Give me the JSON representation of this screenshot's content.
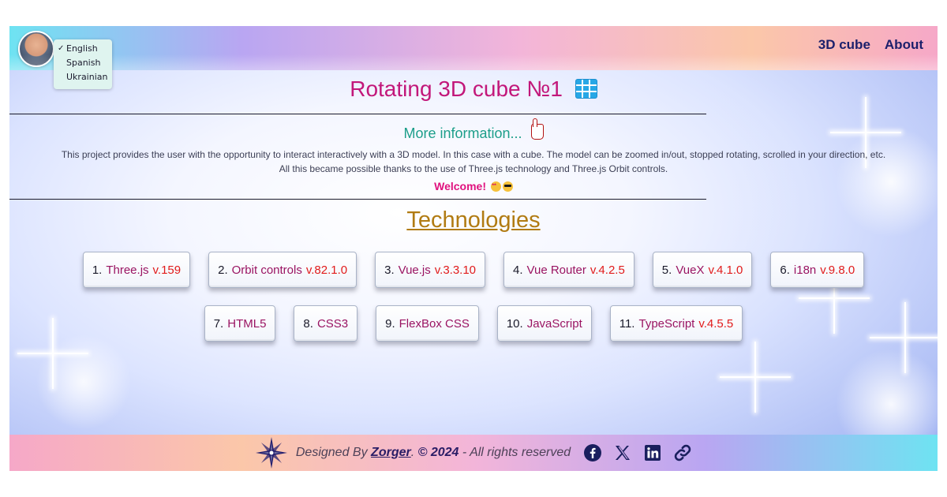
{
  "header": {
    "languages": [
      {
        "label": "English",
        "selected": true,
        "check": "✓"
      },
      {
        "label": "Spanish",
        "selected": false
      },
      {
        "label": "Ukrainian",
        "selected": false
      }
    ],
    "nav": [
      {
        "label": "3D cube"
      },
      {
        "label": "About"
      }
    ]
  },
  "main": {
    "title": "Rotating 3D cube №1",
    "title_icon": "grid-table-icon",
    "more_info": "More information...",
    "more_info_icon": "pointing-hand-icon",
    "description_line1": "This project provides the user with the opportunity to interact interactively with a 3D model. In this case with a cube. The model can be zoomed in/out, stopped rotating, scrolled in your direction, etc.",
    "description_line2": "All this became possible thanks to the use of Three.js technology and Three.js Orbit controls.",
    "welcome": "Welcome!",
    "technologies_title": "Technologies",
    "technologies_row1": [
      {
        "num": "1.",
        "name": "Three.js",
        "version": "v.159"
      },
      {
        "num": "2.",
        "name": "Orbit controls",
        "version": "v.82.1.0"
      },
      {
        "num": "3.",
        "name": "Vue.js",
        "version": "v.3.3.10"
      },
      {
        "num": "4.",
        "name": "Vue Router",
        "version": "v.4.2.5"
      },
      {
        "num": "5.",
        "name": "VueX",
        "version": "v.4.1.0"
      },
      {
        "num": "6.",
        "name": "i18n",
        "version": "v.9.8.0"
      }
    ],
    "technologies_row2": [
      {
        "num": "7.",
        "name": "HTML5",
        "version": ""
      },
      {
        "num": "8.",
        "name": "CSS3",
        "version": ""
      },
      {
        "num": "9.",
        "name": "FlexBox CSS",
        "version": ""
      },
      {
        "num": "10.",
        "name": "JavaScript",
        "version": ""
      },
      {
        "num": "11.",
        "name": "TypeScript",
        "version": "v.4.5.5"
      }
    ]
  },
  "footer": {
    "designed_by": "Designed By",
    "author": "Zorger",
    "copyright": "© 2024",
    "rights": "- All rights reserved",
    "social_icons": [
      "facebook-icon",
      "x-icon",
      "linkedin-icon",
      "link-icon"
    ]
  },
  "colors": {
    "title": "#c2177a",
    "more_info": "#1c9e8a",
    "tech_title": "#b17b12",
    "version": "#e11b1b",
    "nav": "#1b1f6b"
  }
}
